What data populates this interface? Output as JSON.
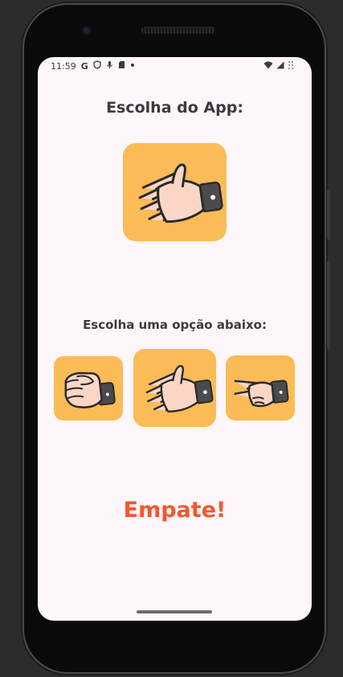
{
  "status_bar": {
    "time": "11:59",
    "left_icons": [
      "google-icon",
      "shield-icon",
      "mic-icon",
      "sd-card-icon",
      "dot-icon"
    ],
    "right_icons": [
      "wifi-icon",
      "signal-icon",
      "battery-icon"
    ]
  },
  "app": {
    "title": "Escolha do App:",
    "app_choice_icon": "paper-hand-icon",
    "prompt": "Escolha uma opção abaixo:",
    "options": [
      {
        "name": "rock",
        "icon": "rock-fist-icon"
      },
      {
        "name": "paper",
        "icon": "paper-hand-icon"
      },
      {
        "name": "scissors",
        "icon": "scissors-hand-icon"
      }
    ],
    "result": "Empate!"
  },
  "colors": {
    "background": "#fdf6fb",
    "tile": "#fbbb56",
    "text": "#3a3a40",
    "result": "#f4572a"
  }
}
